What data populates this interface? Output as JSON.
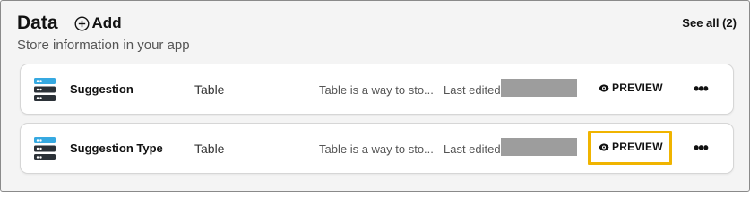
{
  "header": {
    "title": "Data",
    "add_label": "Add",
    "subtitle": "Store information in your app",
    "see_all": "See all (2)"
  },
  "rows": [
    {
      "name": "Suggestion",
      "type": "Table",
      "description": "Table is a way to sto...",
      "edited_label": "Last edited",
      "preview_label": "PREVIEW",
      "more_label": "•••"
    },
    {
      "name": "Suggestion Type",
      "type": "Table",
      "description": "Table is a way to sto...",
      "edited_label": "Last edited",
      "preview_label": "PREVIEW",
      "more_label": "•••"
    }
  ],
  "colors": {
    "highlight": "#f0b400",
    "db_icon_primary": "#2b3137",
    "db_icon_accent": "#36a9e1",
    "redaction": "#9d9d9d"
  },
  "icons": {
    "add": "plus-circle-icon",
    "table": "database-icon",
    "preview": "eye-icon",
    "more": "more-horizontal-icon"
  }
}
